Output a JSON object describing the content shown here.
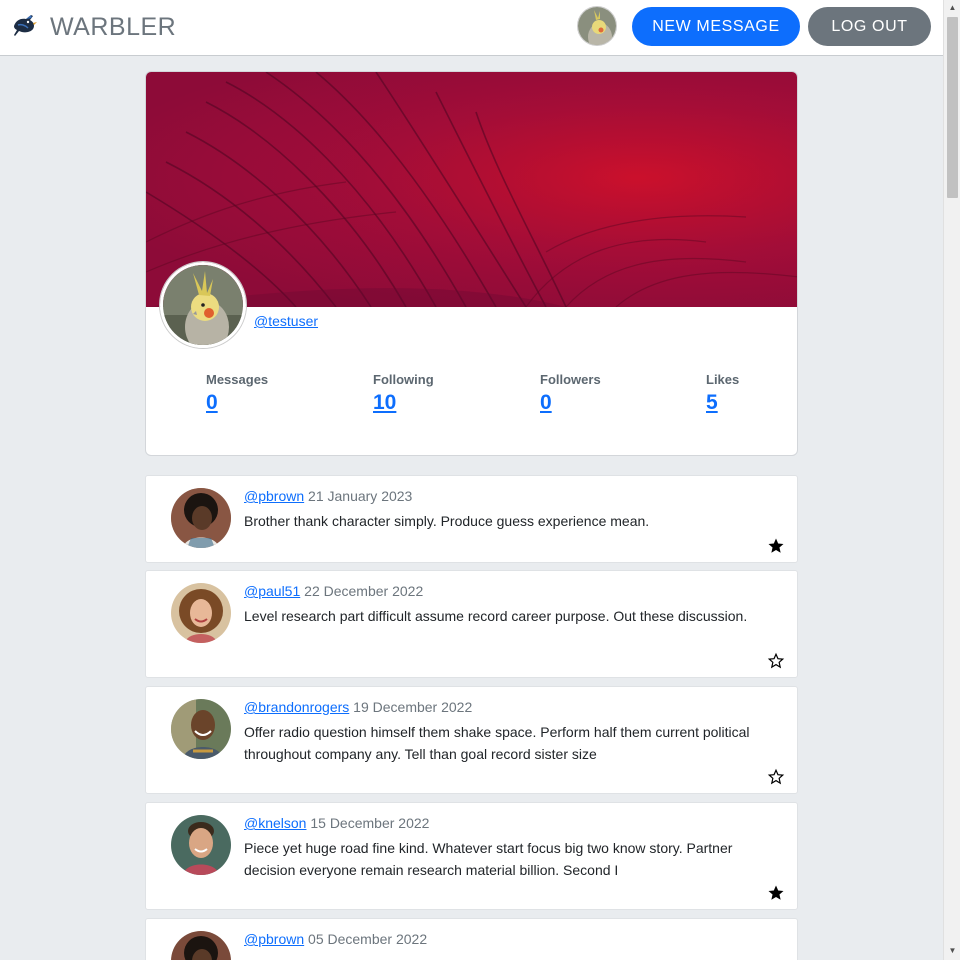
{
  "navbar": {
    "brand": "WARBLER",
    "new_message_label": "NEW MESSAGE",
    "logout_label": "LOG OUT"
  },
  "profile": {
    "username": "@testuser",
    "stats": [
      {
        "label": "Messages",
        "value": "0"
      },
      {
        "label": "Following",
        "value": "10"
      },
      {
        "label": "Followers",
        "value": "0"
      },
      {
        "label": "Likes",
        "value": "5"
      }
    ]
  },
  "messages": [
    {
      "user": "@pbrown",
      "date": "21 January 2023",
      "text": "Brother thank character simply. Produce guess experience mean.",
      "liked": true,
      "avatar": "woman-dark-curly"
    },
    {
      "user": "@paul51",
      "date": "22 December 2022",
      "text": "Level research part difficult assume record career purpose. Out these discussion.",
      "liked": false,
      "avatar": "woman-curly-smile"
    },
    {
      "user": "@brandonrogers",
      "date": "19 December 2022",
      "text": "Offer radio question himself them shake space. Perform half them current political throughout company any. Tell than goal record sister size",
      "liked": false,
      "avatar": "man-bald-smile"
    },
    {
      "user": "@knelson",
      "date": "15 December 2022",
      "text": "Piece yet huge road fine kind. Whatever start focus big two know story. Partner decision everyone remain research material billion. Second I",
      "liked": true,
      "avatar": "man-short-hair"
    },
    {
      "user": "@pbrown",
      "date": "05 December 2022",
      "text": "",
      "liked": false,
      "avatar": "woman-dark-curly"
    }
  ]
}
